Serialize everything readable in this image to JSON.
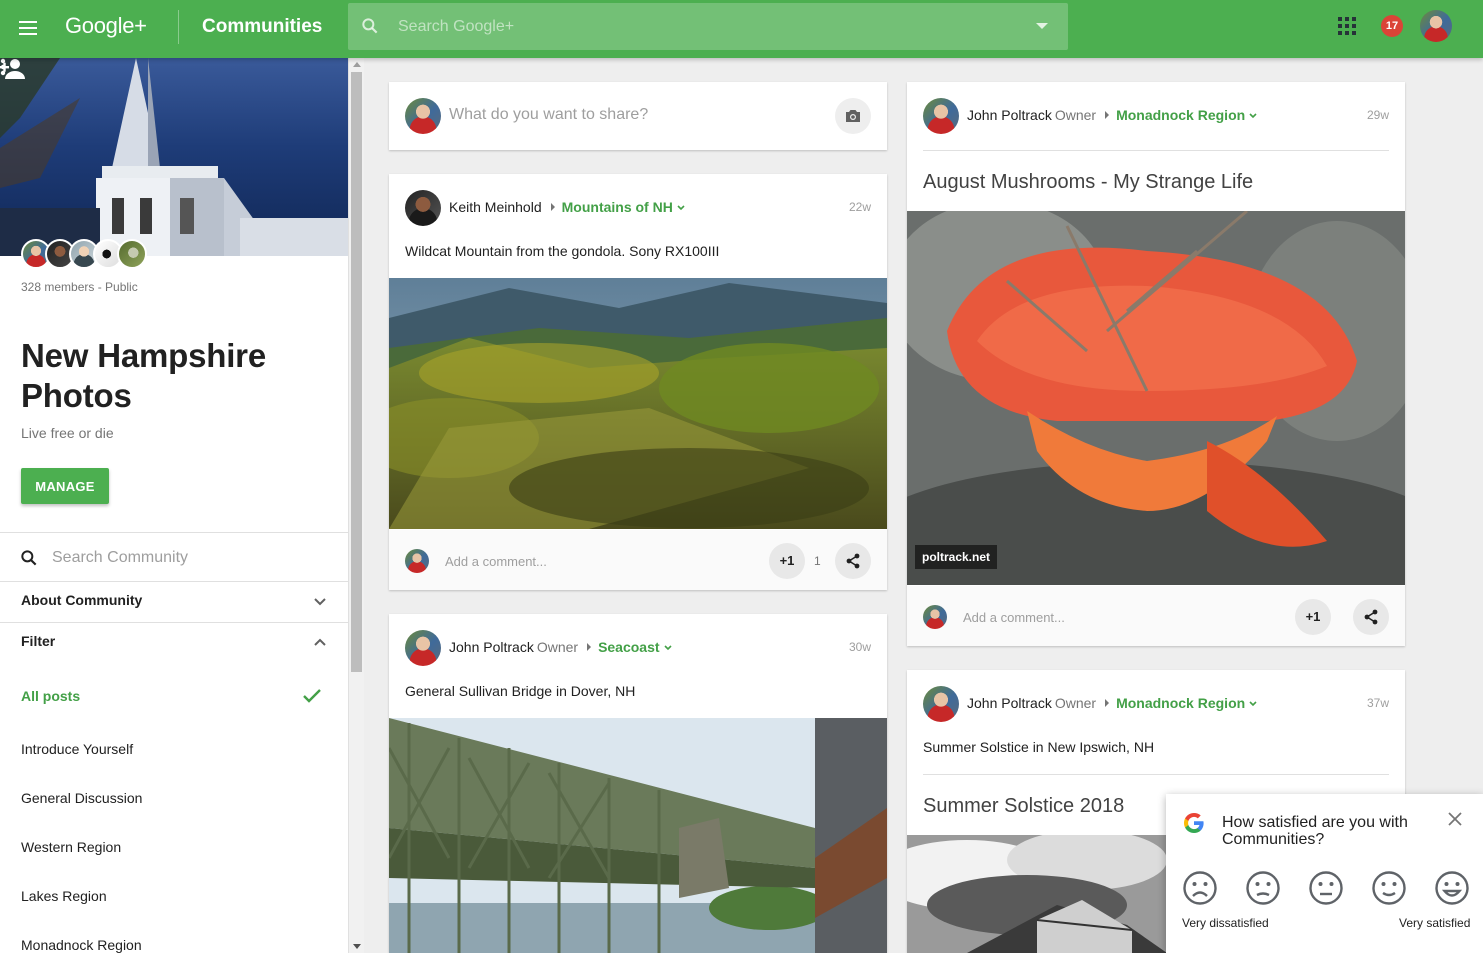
{
  "app": {
    "brand": "Google+",
    "section": "Communities",
    "search_placeholder": "Search Google+",
    "notification_count": "17"
  },
  "community": {
    "members_meta": "328 members - Public",
    "name": "New Hampshire Photos",
    "tagline": "Live free or die",
    "manage_label": "MANAGE",
    "search_placeholder": "Search Community",
    "about_label": "About Community",
    "filter_label": "Filter",
    "filters": [
      {
        "label": "All posts",
        "active": true
      },
      {
        "label": "Introduce Yourself"
      },
      {
        "label": "General Discussion"
      },
      {
        "label": "Western Region"
      },
      {
        "label": "Lakes Region"
      },
      {
        "label": "Monadnock Region"
      }
    ]
  },
  "share_box": {
    "prompt": "What do you want to share?"
  },
  "comment_placeholder": "Add a comment...",
  "plus_one_label": "+1",
  "posts": [
    {
      "author": "Keith Meinhold",
      "role": "",
      "category": "Mountains of NH",
      "time": "22w",
      "text": "Wildcat Mountain from the gondola.  Sony RX100III",
      "plus_count": "1"
    },
    {
      "author": "John Poltrack",
      "role": "Owner",
      "category": "Seacoast",
      "time": "30w",
      "text": "General Sullivan Bridge in Dover, NH"
    },
    {
      "author": "John Poltrack",
      "role": "Owner",
      "category": "Monadnock Region",
      "time": "29w",
      "title": "August Mushrooms - My Strange Life",
      "watermark": "poltrack.net"
    },
    {
      "author": "John Poltrack",
      "role": "Owner",
      "category": "Monadnock Region",
      "time": "37w",
      "text": "Summer Solstice in New Ipswich, NH",
      "title": "Summer Solstice 2018"
    }
  ],
  "survey": {
    "question": "How satisfied are you with Communities?",
    "low_label": "Very dissatisfied",
    "high_label": "Very satisfied"
  },
  "colors": {
    "brand_green": "#4caf50",
    "link_green": "#43a047",
    "notification_red": "#db4437"
  }
}
